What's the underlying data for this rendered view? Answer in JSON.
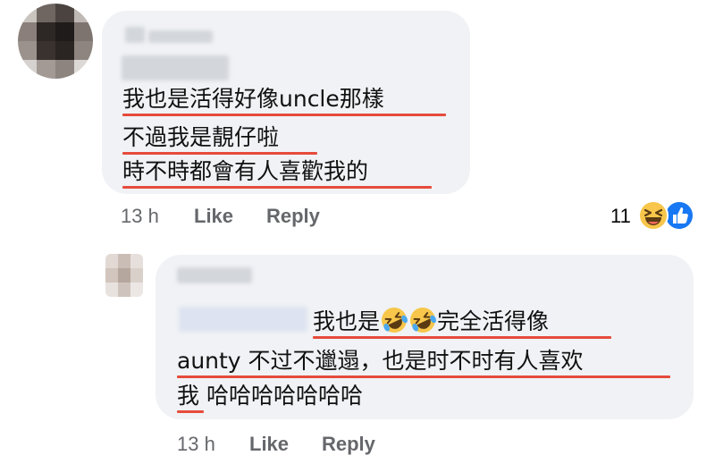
{
  "comments": [
    {
      "lines": [
        "我也是活得好像uncle那樣",
        "不過我是靚仔啦",
        "時不時都會有人喜歡我的"
      ],
      "time": "13 h",
      "like_label": "Like",
      "reply_label": "Reply",
      "reaction_count": "11",
      "reaction_icons": [
        "laughing-emoji-icon",
        "like-thumb-icon"
      ]
    },
    {
      "line1_before": "我也是",
      "line1_emojis": [
        "rofl-emoji-icon",
        "rofl-emoji-icon"
      ],
      "line1_after": "完全活得像",
      "line2": "aunty 不过不邋遢，也是时不时有人喜欢",
      "line3_start": "我",
      "line3_rest": " 哈哈哈哈哈哈哈",
      "time": "13 h",
      "like_label": "Like",
      "reply_label": "Reply"
    }
  ],
  "colors": {
    "bubble": "#f0f2f5",
    "underline": "#e64b3c",
    "meta_text": "#65676b",
    "like_blue": "#1877f2",
    "emoji_yellow": "#f7c64a"
  }
}
